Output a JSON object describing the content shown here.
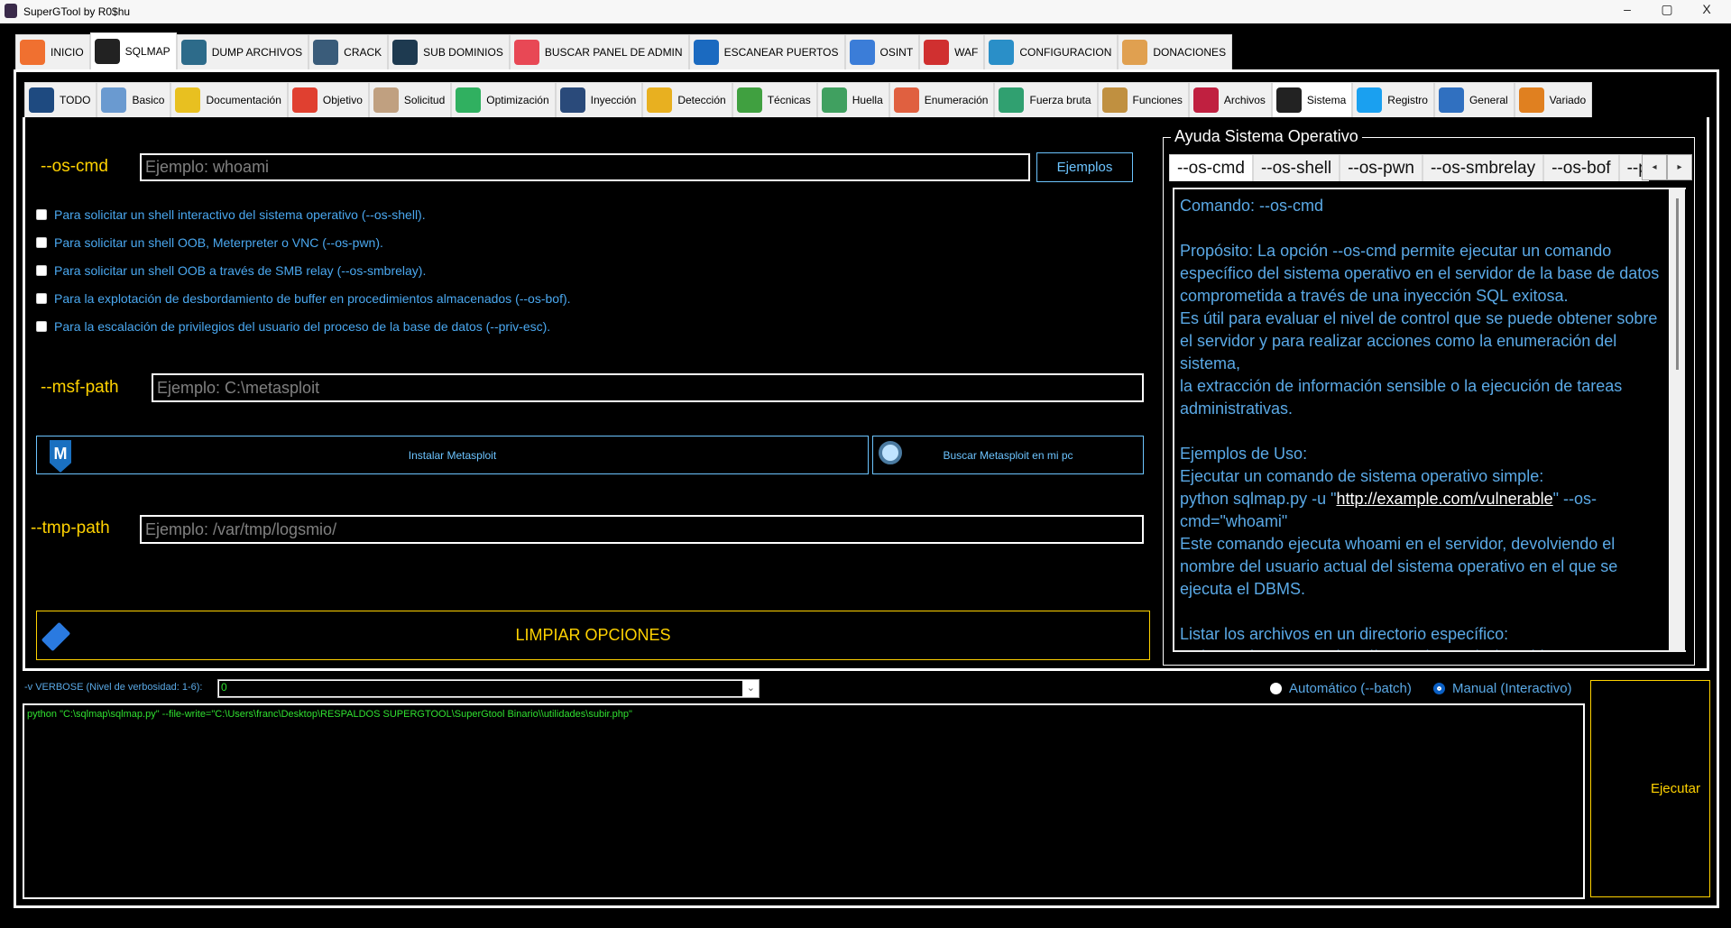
{
  "window": {
    "title": "SuperGTool by R0$hu",
    "minimize": "–",
    "maximize": "▢",
    "close": "X"
  },
  "main_tabs": [
    {
      "label": "INICIO",
      "icon": "home-icon",
      "color": "#f07030"
    },
    {
      "label": "SQLMAP",
      "icon": "terminal-icon",
      "color": "#222",
      "selected": true
    },
    {
      "label": "DUMP ARCHIVOS",
      "icon": "database-download-icon",
      "color": "#2d6b8a"
    },
    {
      "label": "CRACK",
      "icon": "password-lock-icon",
      "color": "#3a5c7a"
    },
    {
      "label": "SUB DOMINIOS",
      "icon": "globe-network-icon",
      "color": "#1e3a50"
    },
    {
      "label": "BUSCAR PANEL DE ADMIN",
      "icon": "admin-panel-icon",
      "color": "#e84855"
    },
    {
      "label": "ESCANEAR PUERTOS",
      "icon": "port-scan-icon",
      "color": "#1b6ac0"
    },
    {
      "label": "OSINT",
      "icon": "osint-lock-icon",
      "color": "#3b7dd8"
    },
    {
      "label": "WAF",
      "icon": "firewall-icon",
      "color": "#d03030"
    },
    {
      "label": "CONFIGURACION",
      "icon": "gear-icon",
      "color": "#2a8fc8"
    },
    {
      "label": "DONACIONES",
      "icon": "donate-box-icon",
      "color": "#e0a050"
    }
  ],
  "sub_tabs": [
    {
      "label": "TODO",
      "icon": "hacker-icon",
      "color": "#1e4a80"
    },
    {
      "label": "Basico",
      "icon": "robot-icon",
      "color": "#6a9ad0"
    },
    {
      "label": "Documentación",
      "icon": "sql-document-icon",
      "color": "#e8c020"
    },
    {
      "label": "Objetivo",
      "icon": "target-icon",
      "color": "#e04030"
    },
    {
      "label": "Solicitud",
      "icon": "request-icon",
      "color": "#c0a080"
    },
    {
      "label": "Optimización",
      "icon": "speedometer-icon",
      "color": "#30b060"
    },
    {
      "label": "Inyección",
      "icon": "database-inject-icon",
      "color": "#2a4a7a"
    },
    {
      "label": "Detección",
      "icon": "warning-magnifier-icon",
      "color": "#e8b020"
    },
    {
      "label": "Técnicas",
      "icon": "lightbulb-gear-icon",
      "color": "#40a040"
    },
    {
      "label": "Huella",
      "icon": "fingerprint-icon",
      "color": "#40a060"
    },
    {
      "label": "Enumeración",
      "icon": "server-user-icon",
      "color": "#e06040"
    },
    {
      "label": "Fuerza bruta",
      "icon": "binary-icon",
      "color": "#30a070"
    },
    {
      "label": "Funciones",
      "icon": "head-gears-icon",
      "color": "#c09040"
    },
    {
      "label": "Archivos",
      "icon": "root-file-icon",
      "color": "#c02040"
    },
    {
      "label": "Sistema",
      "icon": "linux-penguin-icon",
      "color": "#222",
      "selected": true
    },
    {
      "label": "Registro",
      "icon": "windows-icon",
      "color": "#1aa0f0"
    },
    {
      "label": "General",
      "icon": "globe-cycle-icon",
      "color": "#3070c0"
    },
    {
      "label": "Variado",
      "icon": "toolbox-icon",
      "color": "#e08020"
    }
  ],
  "os_cmd": {
    "label": "--os-cmd",
    "placeholder": "Ejemplo: whoami",
    "value": "",
    "examples_button": "Ejemplos"
  },
  "checkboxes": [
    {
      "label": "Para solicitar un shell interactivo del sistema operativo (--os-shell).",
      "checked": false
    },
    {
      "label": "Para solicitar un shell OOB, Meterpreter o VNC (--os-pwn).",
      "checked": false
    },
    {
      "label": "Para solicitar un shell OOB a través de SMB relay (--os-smbrelay).",
      "checked": false
    },
    {
      "label": "Para la explotación de desbordamiento de buffer en procedimientos almacenados (--os-bof).",
      "checked": false
    },
    {
      "label": "Para la escalación de privilegios del usuario del proceso de la base de datos (--priv-esc).",
      "checked": false
    }
  ],
  "msf_path": {
    "label": "--msf-path",
    "placeholder": "Ejemplo: C:\\metasploit",
    "value": ""
  },
  "install_metasploit": {
    "label": "Instalar Metasploit",
    "icon": "metasploit-icon"
  },
  "find_metasploit": {
    "label": "Buscar Metasploit en mi pc",
    "icon": "magnifier-icon"
  },
  "tmp_path": {
    "label": "--tmp-path",
    "placeholder": "Ejemplo: /var/tmp/logsmio/",
    "value": ""
  },
  "clear_button": {
    "label": "LIMPIAR OPCIONES",
    "icon": "eraser-icon"
  },
  "help": {
    "title": "Ayuda Sistema Operativo",
    "tabs": [
      "--os-cmd",
      "--os-shell",
      "--os-pwn",
      "--os-smbrelay",
      "--os-bof",
      "--priv-esc"
    ],
    "selected_tab": "--os-cmd",
    "text_before_link": "Comando: --os-cmd\n\nPropósito: La opción --os-cmd permite ejecutar un comando específico del sistema operativo en el servidor de la base de datos comprometida a través de una inyección SQL exitosa.\nEs útil para evaluar el nivel de control que se puede obtener sobre el servidor y para realizar acciones como la enumeración del sistema,\nla extracción de información sensible o la ejecución de tareas administrativas.\n\nEjemplos de Uso:\nEjecutar un comando de sistema operativo simple:\npython sqlmap.py -u \"",
    "link": "http://example.com/vulnerable",
    "text_after_link": "\" --os-cmd=\"whoami\"\nEste comando ejecuta whoami en el servidor, devolviendo el nombre del usuario actual del sistema operativo en el que se ejecuta el DBMS.\n\nListar los archivos en un directorio específico:\npython sqlmap.py -u \"http://example.com/vulnerable\""
  },
  "verbose": {
    "label": "-v VERBOSE (Nivel de verbosidad: 1-6):",
    "value": "0"
  },
  "mode": {
    "options": [
      {
        "label": "Automático (--batch)",
        "selected": false
      },
      {
        "label": "Manual (Interactivo)",
        "selected": true
      }
    ]
  },
  "command_output": "python \"C:\\sqlmap\\sqlmap.py\" --file-write=\"C:\\Users\\franc\\Desktop\\RESPALDOS SUPERGTOOL\\SuperGtool Binario\\\\utilidades\\subir.php\"",
  "execute_button": "Ejecutar",
  "colors": {
    "label": "#ffd200",
    "text": "#4aa8f0",
    "output": "#30e030",
    "border_blue": "#6cc4ff"
  }
}
